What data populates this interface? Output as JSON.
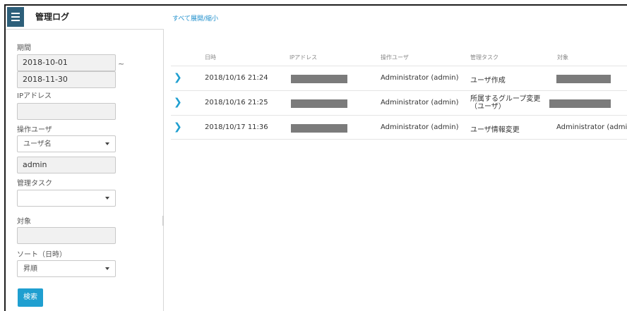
{
  "sidebar": {
    "title": "管理ログ",
    "period_label": "期間",
    "period_from": "2018-10-01",
    "period_to": "2018-11-30",
    "tilde": "~",
    "ip_label": "IPアドレス",
    "ip_value": "",
    "operator_label": "操作ユーザ",
    "operator_select": "ユーザ名",
    "operator_value": "admin",
    "task_label": "管理タスク",
    "task_select": "",
    "target_label": "対象",
    "target_value": "",
    "sort_label": "ソート（日時）",
    "sort_select": "昇順",
    "search_button": "検索"
  },
  "main": {
    "expand_link": "すべて展開/縮小",
    "columns": [
      "日時",
      "IPアドレス",
      "操作ユーザ",
      "管理タスク",
      "対象"
    ],
    "rows": [
      {
        "datetime": "2018/10/16 21:24",
        "user": "Administrator (admin)",
        "task": "ユーザ作成",
        "target": ""
      },
      {
        "datetime": "2018/10/16 21:25",
        "user": "Administrator (admin)",
        "task": "所属するグループ変更（ユーザ）",
        "target": ""
      },
      {
        "datetime": "2018/10/17 11:36",
        "user": "Administrator (admin)",
        "task": "ユーザ情報変更",
        "target": "Administrator (admin)"
      }
    ]
  },
  "colors": {
    "menu_button": "#2d5f7a",
    "accent": "#1f9fd0",
    "redaction": "#7b7b7b"
  }
}
